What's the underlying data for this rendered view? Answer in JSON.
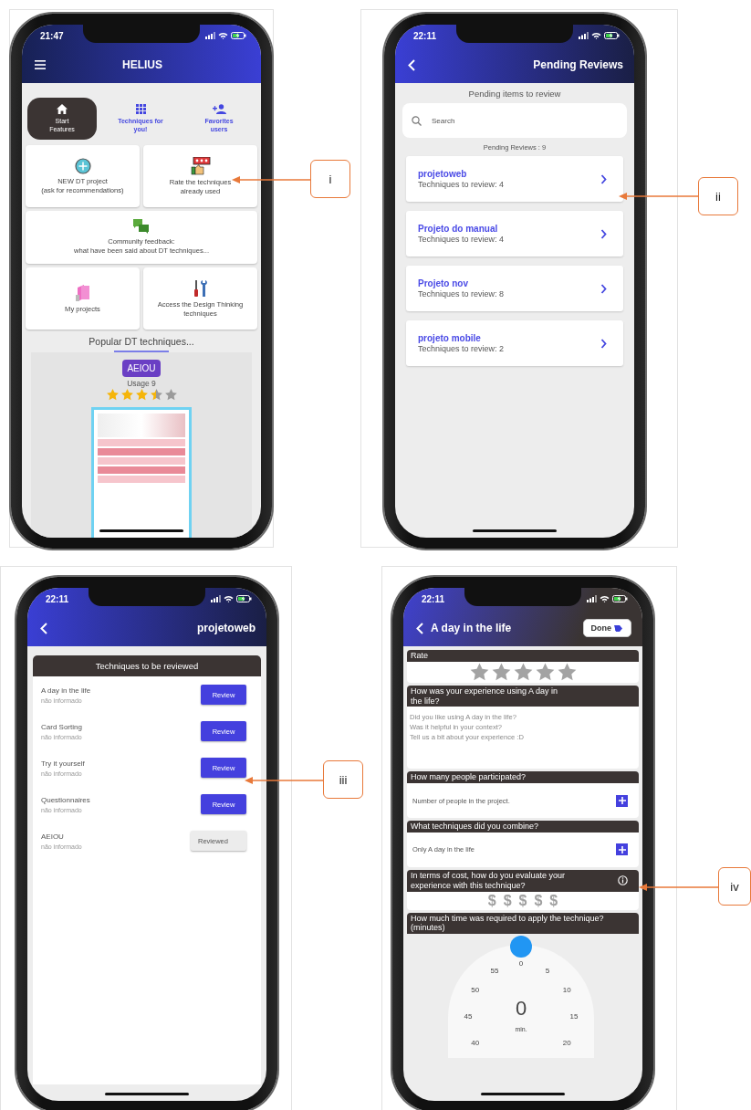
{
  "panels": [
    {
      "kind": "home",
      "callout": "i",
      "time": "21:47",
      "title": "HELIUS",
      "nav": [
        {
          "kind": "home",
          "lines": [
            "Start",
            "Features"
          ],
          "selected": true
        },
        {
          "kind": "techniques",
          "lines": [
            "Techniques for",
            "you!"
          ],
          "selected": false
        },
        {
          "kind": "favorites",
          "lines": [
            "Favorites",
            "users"
          ],
          "selected": false
        }
      ],
      "tiles": [
        {
          "kind": "new",
          "lines": [
            "NEW DT project",
            "(ask for recommendations)"
          ]
        },
        {
          "kind": "rate",
          "lines": [
            "Rate the techniques",
            "already used"
          ]
        },
        {
          "kind": "community",
          "lines": [
            "Community feedback:",
            "what have been said about DT techniques..."
          ]
        },
        {
          "kind": "projects",
          "lines": [
            "My projects"
          ]
        },
        {
          "kind": "techniques",
          "lines": [
            "Access the Design Thinking",
            "techniques"
          ]
        }
      ],
      "section_title": "Popular DT techniques...",
      "featured": {
        "badge": "AEIOU",
        "usage": "Usage 9",
        "stars": 3.5
      }
    },
    {
      "kind": "pending",
      "callout": "ii",
      "time": "22:11",
      "title": "Pending Reviews",
      "heading": "Pending items to review",
      "search": {
        "placeholder": "Search"
      },
      "count": "Pending Reviews : 9",
      "items": [
        {
          "name": "projetoweb",
          "sub": "Techniques to review: 4"
        },
        {
          "name": "Projeto do manual",
          "sub": "Techniques to review: 4"
        },
        {
          "name": "Projeto nov",
          "sub": "Techniques to review: 8"
        },
        {
          "name": "projeto mobile",
          "sub": "Techniques to review: 2"
        }
      ]
    },
    {
      "kind": "list",
      "callout": "iii",
      "time": "22:11",
      "title": "projetoweb",
      "card_title": "Techniques to be reviewed",
      "rows": [
        {
          "name": "A day in the life",
          "note": "não informado",
          "button": "Review",
          "reviewed": false
        },
        {
          "name": "Card Sorting",
          "note": "não informado",
          "button": "Review",
          "reviewed": false
        },
        {
          "name": "Try it yourself",
          "note": "não informado",
          "button": "Review",
          "reviewed": false
        },
        {
          "name": "Questionnaires",
          "note": "não informado",
          "button": "Review",
          "reviewed": false
        },
        {
          "name": "AEIOU",
          "note": "não informado",
          "button": "Reviewed",
          "reviewed": true
        }
      ]
    },
    {
      "kind": "rate",
      "callout": "iv",
      "time": "22:11",
      "title": "A day in the life",
      "done": "Done",
      "sections": [
        {
          "kind": "stars",
          "label": "Rate"
        },
        {
          "kind": "text",
          "label": "How was your experience using A day in the life?",
          "placeholder": "Did you like using A day in the life?\nWas it helpful in your context?\nTell us a bit about your experience :D"
        },
        {
          "kind": "add",
          "label": "How many people participated?",
          "value": "Number of people in the project."
        },
        {
          "kind": "add",
          "label": "What techniques did you combine?",
          "value": "Only A day in the life"
        },
        {
          "kind": "cost",
          "label": "In terms of cost, how do you evaluate your experience with this technique?",
          "symbols": [
            "$",
            "$",
            "$",
            "$",
            "$"
          ]
        },
        {
          "kind": "time",
          "label": "How much time was required to apply the technique? (minutes)",
          "marks": [
            "40",
            "45",
            "50",
            "55",
            "0",
            "5",
            "10",
            "15",
            "20"
          ],
          "value": "0",
          "unit": "min."
        }
      ]
    }
  ]
}
